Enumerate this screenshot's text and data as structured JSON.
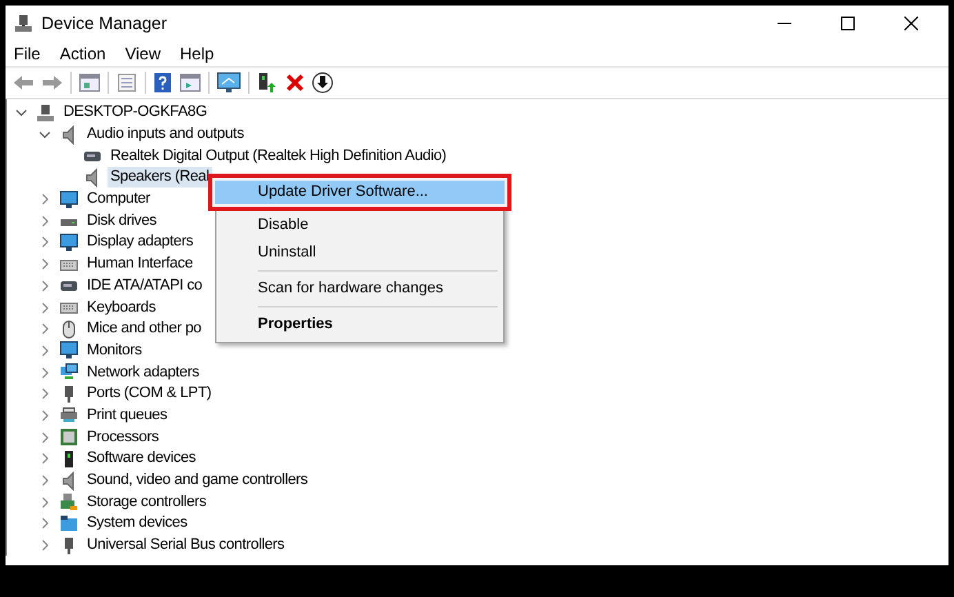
{
  "window": {
    "title": "Device Manager"
  },
  "menu_bar": [
    "File",
    "Action",
    "View",
    "Help"
  ],
  "tree": [
    {
      "label": "DESKTOP-OGKFA8G",
      "selected": false,
      "expanded": true,
      "children": [
        {
          "label": "Audio inputs and outputs",
          "selected": false,
          "expanded": true,
          "children": [
            {
              "label": "Realtek Digital Output (Realtek High Definition Audio)",
              "selected": false
            },
            {
              "label": "Speakers (Real",
              "selected": true
            }
          ]
        },
        {
          "label": "Computer",
          "selected": false,
          "expanded": false
        },
        {
          "label": "Disk drives",
          "selected": false,
          "expanded": false
        },
        {
          "label": "Display adapters",
          "selected": false,
          "expanded": false
        },
        {
          "label": "Human Interface",
          "selected": false,
          "expanded": false
        },
        {
          "label": "IDE ATA/ATAPI co",
          "selected": false,
          "expanded": false
        },
        {
          "label": "Keyboards",
          "selected": false,
          "expanded": false
        },
        {
          "label": "Mice and other po",
          "selected": false,
          "expanded": false
        },
        {
          "label": "Monitors",
          "selected": false,
          "expanded": false
        },
        {
          "label": "Network adapters",
          "selected": false,
          "expanded": false
        },
        {
          "label": "Ports (COM & LPT)",
          "selected": false,
          "expanded": false
        },
        {
          "label": "Print queues",
          "selected": false,
          "expanded": false
        },
        {
          "label": "Processors",
          "selected": false,
          "expanded": false
        },
        {
          "label": "Software devices",
          "selected": false,
          "expanded": false
        },
        {
          "label": "Sound, video and game controllers",
          "selected": false,
          "expanded": false
        },
        {
          "label": "Storage controllers",
          "selected": false,
          "expanded": false
        },
        {
          "label": "System devices",
          "selected": false,
          "expanded": false
        },
        {
          "label": "Universal Serial Bus controllers",
          "selected": false,
          "expanded": false
        }
      ]
    }
  ],
  "context_menu": [
    {
      "kind": "item",
      "label": "Update Driver Software...",
      "selected": true,
      "annotated": true
    },
    {
      "kind": "item",
      "label": "Disable",
      "selected": false,
      "annotated": false
    },
    {
      "kind": "item",
      "label": "Uninstall",
      "selected": false,
      "annotated": false
    },
    {
      "kind": "separator"
    },
    {
      "kind": "item",
      "label": "Scan for hardware changes",
      "selected": false,
      "annotated": false
    },
    {
      "kind": "separator"
    },
    {
      "kind": "default",
      "label": "Properties",
      "selected": false,
      "annotated": false
    }
  ]
}
